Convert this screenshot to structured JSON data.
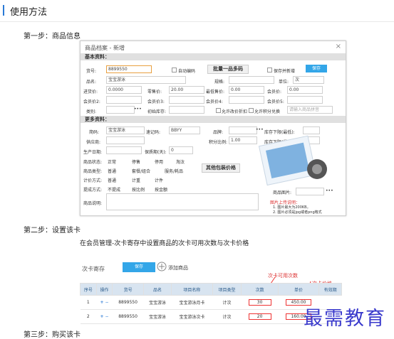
{
  "page_title": "使用方法",
  "steps": {
    "s1": "第一步：商品信息",
    "s2": "第二步：设置该卡",
    "s3": "第三步：购买该卡"
  },
  "dialog": {
    "title": "商品档案 - 新增",
    "basic_header": "基本资料：",
    "more_header": "更多资料：",
    "labels": {
      "code": "货号:",
      "auto_code": "自动编码",
      "select_multi": "批量一品多码",
      "keep_new": "保存并新增",
      "save": "保存",
      "name": "品名:",
      "spec": "规格:",
      "unit": "单位:",
      "purchase": "进货价:",
      "retail": "零售价:",
      "min_price": "最低售价:",
      "member_price": "会员价:",
      "member_price2": "会员价2:",
      "member_price3": "会员价3:",
      "member_price4": "会员价4:",
      "member_price5": "会员价5:",
      "category": "类别:",
      "init_stock": "初始库存:",
      "allow_discount": "允许改价折扣",
      "allow_points": "允许积分兑换",
      "pinyin": "简码:",
      "quick_code": "速记码:",
      "brand": "品牌:",
      "stock_upper": "库存下限(最低):",
      "supplier": "供应商:",
      "points_ratio": "积分比例:",
      "stock_lower": "库存下限(最低):",
      "produce_date": "生产日期:",
      "shelf_life": "保质期(天):",
      "status": "商品状态:",
      "type": "商品类型:",
      "price_mode": "计价方式:",
      "rebate": "提成方式:",
      "remark": "商品说明:",
      "package_btn": "其他包装价格",
      "image_label": "商品图片:",
      "upload_title": "图片上传说明：",
      "upload_1": "1. 图片最大为200KB。",
      "upload_2": "2. 图片必须是jpg或者png格式"
    },
    "values": {
      "code": "8899550",
      "name": "宝宝游泳",
      "purchase": "0.0000",
      "retail": "20.00",
      "min_price": "0.00",
      "member_price": "0.00",
      "unit": "次",
      "quick": "宝宝游泳",
      "brand_code": "BBYY",
      "shelf": "0",
      "points": "1.00",
      "pinyin_ph": "请输入商品拼音"
    },
    "radios": {
      "status": [
        "正常",
        "停售",
        "停用",
        "淘汰"
      ],
      "type": [
        "普通",
        "套餐/组合",
        "服务/耗品"
      ],
      "price": [
        "普通",
        "计重",
        "计件"
      ],
      "rebate": [
        "不提成",
        "按比例",
        "按金额"
      ]
    }
  },
  "step2": {
    "desc": "在会员管理-次卡寄存中设置商品的次卡可用次数与次卡价格",
    "tab": "次卡寄存",
    "save": "保存",
    "add": "添加商品",
    "ann1": "次卡可用次数",
    "ann2": "次卡价格",
    "headers": [
      "序号",
      "操作",
      "货号",
      "品名",
      "项目名称",
      "项目类型",
      "次数",
      "单价",
      "有效期"
    ],
    "rows": [
      [
        "1",
        "8899550",
        "宝宝游泳",
        "宝宝游泳月卡",
        "计次",
        "30",
        "450.00"
      ],
      [
        "2",
        "8899550",
        "宝宝游泳",
        "宝宝游泳次卡",
        "计次",
        "20",
        "160.00"
      ]
    ]
  },
  "watermark": "最需教育"
}
